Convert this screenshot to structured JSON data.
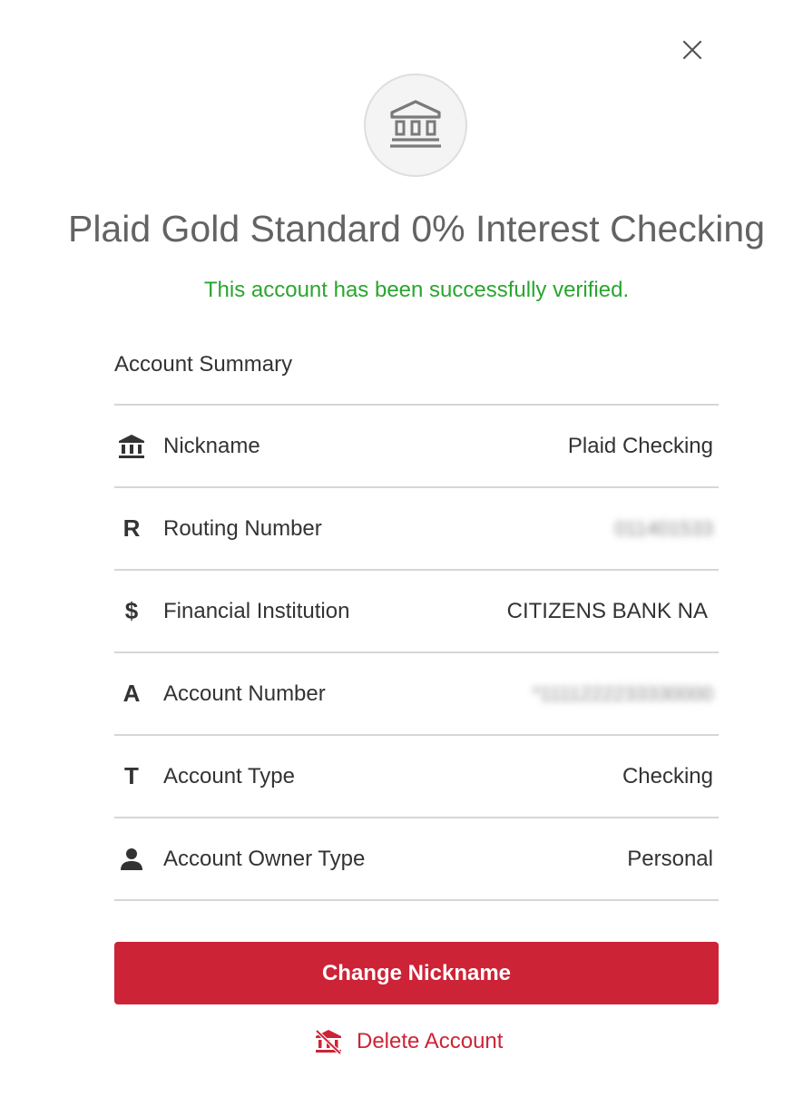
{
  "modal": {
    "close_icon": "close-icon",
    "bank_icon": "bank-icon",
    "title": "Plaid Gold Standard 0% Interest Checking",
    "verified_message": "This account has been successfully verified.",
    "colors": {
      "accent": "#cd2337",
      "success": "#2aa52f",
      "title": "#636363",
      "text": "#333333",
      "divider": "#d6d6d6"
    }
  },
  "summary": {
    "heading": "Account Summary",
    "rows": [
      {
        "icon": "bank-icon",
        "label": "Nickname",
        "value": "Plaid Checking"
      },
      {
        "icon": "letter-r-icon",
        "glyph": "R",
        "label": "Routing Number",
        "value": "011401533"
      },
      {
        "icon": "dollar-icon",
        "glyph": "$",
        "label": "Financial Institution",
        "value": "CITIZENS BANK NA"
      },
      {
        "icon": "letter-a-icon",
        "glyph": "A",
        "label": "Account Number",
        "value": "*1111222233330000"
      },
      {
        "icon": "letter-t-icon",
        "glyph": "T",
        "label": "Account Type",
        "value": "Checking"
      },
      {
        "icon": "person-icon",
        "label": "Account Owner Type",
        "value": "Personal"
      }
    ]
  },
  "actions": {
    "change_nickname_label": "Change Nickname",
    "delete_account_label": "Delete Account",
    "delete_icon": "bank-delete-icon"
  }
}
